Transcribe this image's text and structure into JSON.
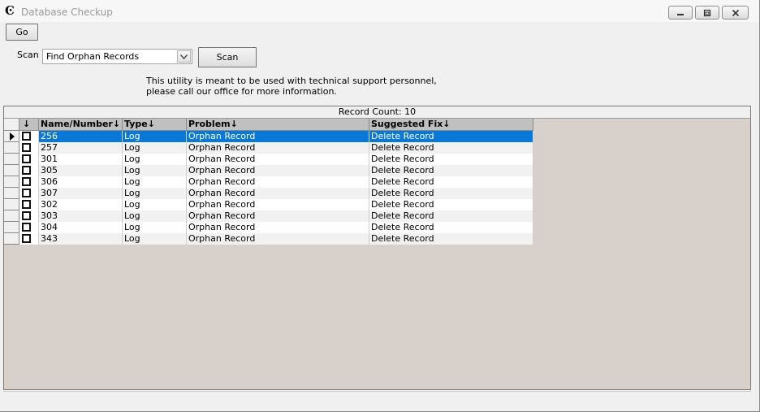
{
  "window": {
    "title": "Database Checkup",
    "icon": "app-logo-icon",
    "controls": {
      "minimize": "minimize-icon",
      "restore": "restore-icon",
      "close": "close-icon"
    }
  },
  "toolbar": {
    "go_label": "Go"
  },
  "scan": {
    "label": "Scan",
    "selected": "Find Orphan Records",
    "button_label": "Scan"
  },
  "info": {
    "line1": "This utility is meant to be used with technical support personnel,",
    "line2": "please call our office for more information."
  },
  "grid": {
    "record_count": "Record Count: 10",
    "sort_arrow": "↓",
    "columns": [
      "Name/Number↓",
      "Type↓",
      "Problem↓",
      "Suggested Fix↓"
    ],
    "selected_row": 0,
    "rows": [
      {
        "name": "256",
        "type": "Log",
        "problem": "Orphan Record",
        "fix": "Delete Record"
      },
      {
        "name": "257",
        "type": "Log",
        "problem": "Orphan Record",
        "fix": "Delete Record"
      },
      {
        "name": "301",
        "type": "Log",
        "problem": "Orphan Record",
        "fix": "Delete Record"
      },
      {
        "name": "305",
        "type": "Log",
        "problem": "Orphan Record",
        "fix": "Delete Record"
      },
      {
        "name": "306",
        "type": "Log",
        "problem": "Orphan Record",
        "fix": "Delete Record"
      },
      {
        "name": "307",
        "type": "Log",
        "problem": "Orphan Record",
        "fix": "Delete Record"
      },
      {
        "name": "302",
        "type": "Log",
        "problem": "Orphan Record",
        "fix": "Delete Record"
      },
      {
        "name": "303",
        "type": "Log",
        "problem": "Orphan Record",
        "fix": "Delete Record"
      },
      {
        "name": "304",
        "type": "Log",
        "problem": "Orphan Record",
        "fix": "Delete Record"
      },
      {
        "name": "343",
        "type": "Log",
        "problem": "Orphan Record",
        "fix": "Delete Record"
      }
    ]
  },
  "colors": {
    "selection": "#0a78d6",
    "grid_background": "#d8d0cb",
    "header_background": "#c0c0c0"
  }
}
